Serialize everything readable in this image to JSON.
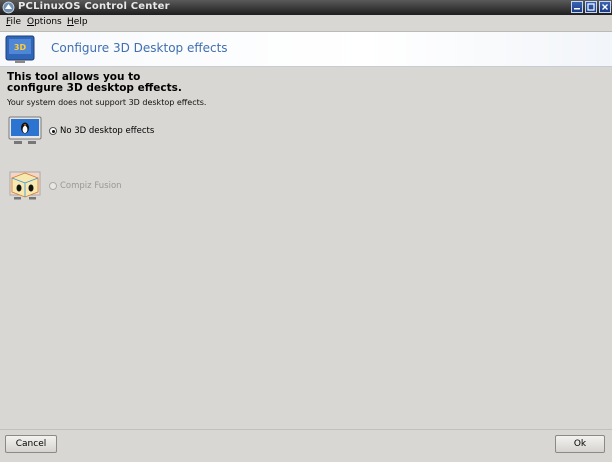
{
  "window": {
    "title": "PCLinuxOS Control Center"
  },
  "menubar": {
    "items": [
      {
        "first": "F",
        "rest": "ile"
      },
      {
        "first": "O",
        "rest": "ptions"
      },
      {
        "first": "H",
        "rest": "elp"
      }
    ]
  },
  "banner": {
    "title": "Configure 3D Desktop effects",
    "icon_text": "3D"
  },
  "content": {
    "heading_line1": "This tool allows you to",
    "heading_line2": "configure 3D desktop effects.",
    "notice": "Your system does not support 3D desktop effects.",
    "options": [
      {
        "label": "No 3D desktop effects",
        "selected": true,
        "enabled": true,
        "icon": "monitor-tux-icon"
      },
      {
        "label": "Compiz Fusion",
        "selected": false,
        "enabled": false,
        "icon": "cube-tux-icon"
      }
    ]
  },
  "footer": {
    "cancel_label": "Cancel",
    "ok_label": "Ok"
  },
  "colors": {
    "banner_title": "#3f6fb0",
    "titlebar": "#2a2a2a",
    "background": "#d9d7d3"
  }
}
